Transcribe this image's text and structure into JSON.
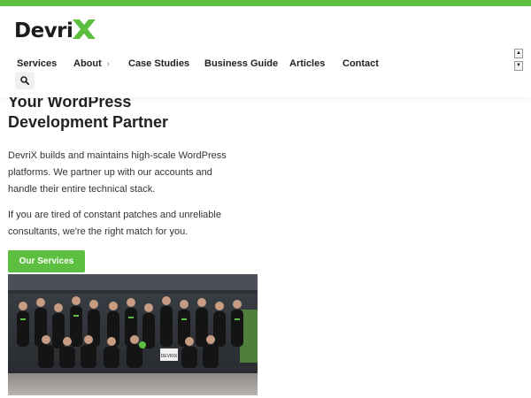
{
  "brand": {
    "name": "Devri",
    "accent_color": "#5cbf3f"
  },
  "nav": {
    "items": [
      {
        "label": "Services"
      },
      {
        "label": "About",
        "has_submenu": true
      },
      {
        "label": "Case Studies"
      },
      {
        "label": "Business Guide"
      },
      {
        "label": "Articles"
      },
      {
        "label": "Contact"
      }
    ],
    "search_icon": "search-icon"
  },
  "scroll_controls": {
    "up": "▲",
    "down": "▼"
  },
  "hero": {
    "title_line1": "Your WordPress",
    "title_line2": "Development Partner",
    "paragraph1_line1": "DevriX builds and maintains high-scale WordPress",
    "paragraph1_line2": "platforms. We partner up with our accounts and",
    "paragraph1_line3": "handle their entire technical stack.",
    "paragraph2_line1": "If you are tired of constant patches and unreliable",
    "paragraph2_line2": "consultants, we're the right match for you.",
    "cta_label": "Our Services"
  },
  "team_photo": {
    "sign_text": "DEVRIX"
  }
}
